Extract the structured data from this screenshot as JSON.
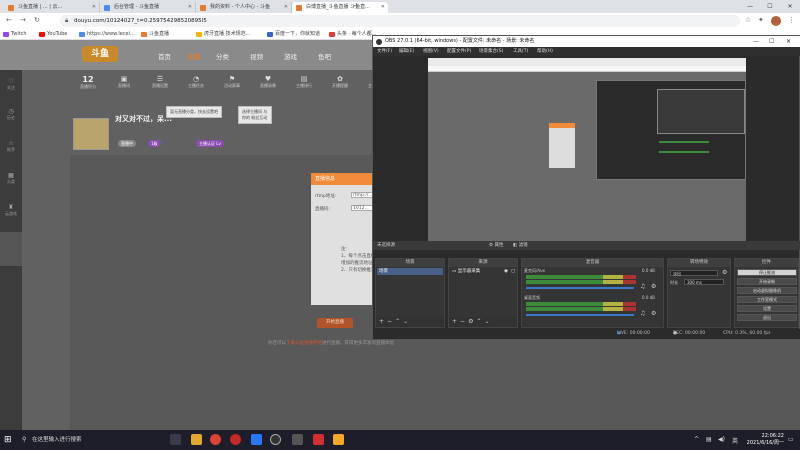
{
  "browser": {
    "tabs": [
      {
        "label": "斗鱼直播 | ... | 云...",
        "color": "#e97a2b"
      },
      {
        "label": "后台管理 - 斗鱼直播",
        "color": "#4c8bf5"
      },
      {
        "label": "我的资料 - 个人中心 - 斗鱼",
        "color": "#e97a2b"
      },
      {
        "label": "白博直播_斗鱼直播 斗鱼直...",
        "color": "#e97a2b",
        "active": true
      }
    ],
    "url": "douyu.com/10124027_t=0.259754298520895l5",
    "bookmarks": [
      {
        "label": "Twitch",
        "color": "#9146ff"
      },
      {
        "label": "YouTube",
        "color": "#ff0000"
      },
      {
        "label": "https://www.lecei...",
        "color": "#4c8bf5"
      },
      {
        "label": "斗鱼直播",
        "color": "#e97a2b"
      },
      {
        "label": "虎牙直播 技术规范...",
        "color": "#f4b400"
      },
      {
        "label": "百度一下，你就知道",
        "color": "#3367d6"
      },
      {
        "label": "头条 · 每个人都...",
        "color": "#e53935"
      }
    ]
  },
  "douyu": {
    "logo": "斗鱼",
    "nav": [
      "首页",
      "直播",
      "分类",
      "视频",
      "游戏",
      "鱼吧"
    ],
    "active_nav": "直播",
    "stats": [
      {
        "num": "12",
        "label": "直播积分"
      },
      {
        "icon": "▣",
        "label": "直播间"
      },
      {
        "icon": "☰",
        "label": "直播设置"
      },
      {
        "icon": "◔",
        "label": "主播任务"
      },
      {
        "icon": "⚑",
        "label": "活动赛事"
      },
      {
        "icon": "♥",
        "label": "直播录像"
      },
      {
        "icon": "▤",
        "label": "主播排行"
      },
      {
        "icon": "✿",
        "label": "开播提醒"
      },
      {
        "icon": "☼",
        "label": "主播认证"
      }
    ],
    "sidebar": [
      "关注",
      "历史",
      "推荐",
      "分类",
      "云游戏"
    ],
    "tooltip1": "暂无直播分类，快去设置吧",
    "tooltip2": "选择主播间 与你的 粉丝互动",
    "room_title": "对又对不过，呆...",
    "room_tags": [
      "直播中",
      "1级",
      "主播认证 Lv"
    ],
    "dialog": {
      "title": "直播信息",
      "rtmp_label": "rtmp地址:",
      "rtmp_value": "rtmp://...",
      "code_label": "直播码:",
      "code_value": "1012...",
      "note_title": "注:",
      "note1": "1、每个点击直播，就...",
      "note2": "增加的推流地址...",
      "note3": "2、只有切换推流..."
    },
    "start_button": "开始直播",
    "bottom_note_prefix": "你还可以",
    "bottom_note_link": "下载斗鱼直播伴侣",
    "bottom_note_suffix": "进行直播，获得更多丰富的直播体验"
  },
  "obs": {
    "title": "OBS 27.0.1 (64-bit, windows) - 配置文件: 未命名 - 场景: 未命名",
    "menu": [
      "文件(F)",
      "编辑(E)",
      "视图(V)",
      "配置文件(P)",
      "场景集合(S)",
      "工具(T)",
      "帮助(H)"
    ],
    "scene_line": "未选择源",
    "properties": "属性",
    "filters": "滤镜",
    "panels": {
      "scenes": {
        "title": "场景",
        "items": [
          "场景"
        ]
      },
      "sources": {
        "title": "来源",
        "items": [
          "显示器采集"
        ]
      },
      "mixer": {
        "title": "混音器",
        "channels": [
          {
            "name": "麦克风/Aux",
            "db": "0.0 dB"
          },
          {
            "name": "桌面音频",
            "db": "0.0 dB"
          }
        ]
      },
      "transitions": {
        "title": "转场特效",
        "type": "淡出",
        "duration_label": "时长",
        "duration": "300 ms"
      },
      "controls": {
        "title": "控件",
        "buttons": [
          "停止推流",
          "开始录制",
          "启动虚拟摄像机",
          "工作室模式",
          "设置",
          "退出"
        ]
      }
    },
    "status": {
      "live": "LIVE: 00:00:00",
      "rec": "REC: 00:00:00",
      "cpu": "CPU: 0.3%, 60.00 fps"
    }
  },
  "taskbar": {
    "search_placeholder": "在这里输入进行搜索",
    "time": "22:06:22",
    "date": "2021/6/16/周一"
  }
}
